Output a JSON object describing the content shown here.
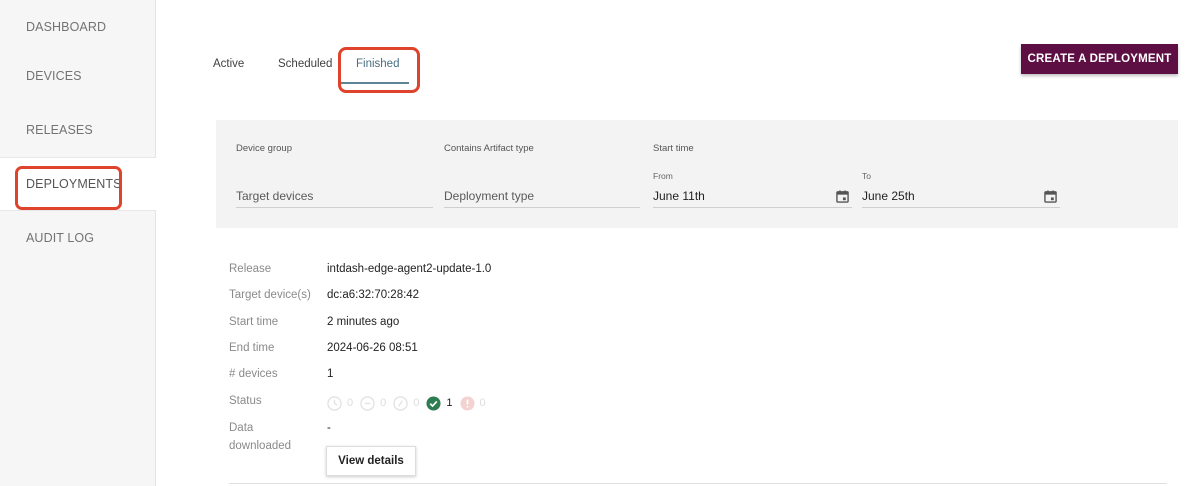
{
  "sidebar": {
    "items": [
      {
        "label": "DASHBOARD"
      },
      {
        "label": "DEVICES"
      },
      {
        "label": "RELEASES"
      },
      {
        "label": "DEPLOYMENTS"
      },
      {
        "label": "AUDIT LOG"
      }
    ],
    "active_item": "DEPLOYMENTS"
  },
  "tabs": [
    {
      "label": "Active"
    },
    {
      "label": "Scheduled"
    },
    {
      "label": "Finished"
    }
  ],
  "active_tab": "Finished",
  "create_button": {
    "label": "CREATE A DEPLOYMENT"
  },
  "filters": {
    "device_group": {
      "label": "Device group",
      "placeholder": "Target devices"
    },
    "artifact_type": {
      "label": "Contains Artifact type",
      "placeholder": "Deployment type"
    },
    "start_time": {
      "label": "Start time",
      "from": {
        "label": "From",
        "value": "June 11th"
      },
      "to": {
        "label": "To",
        "value": "June 25th"
      }
    }
  },
  "deployment": {
    "rows": [
      {
        "label": "Release",
        "value": "intdash-edge-agent2-update-1.0"
      },
      {
        "label": "Target device(s)",
        "value": "dc:a6:32:70:28:42"
      },
      {
        "label": "Start time",
        "value": "2 minutes ago"
      },
      {
        "label": "End time",
        "value": "2024-06-26 08:51"
      },
      {
        "label": "# devices",
        "value": "1"
      }
    ],
    "status": {
      "label": "Status",
      "counts": [
        {
          "icon": "pending-icon",
          "value": "0"
        },
        {
          "icon": "in-progress-icon",
          "value": "0"
        },
        {
          "icon": "paused-icon",
          "value": "0"
        },
        {
          "icon": "success-icon",
          "value": "1",
          "color": "#2e7d52"
        },
        {
          "icon": "failure-icon",
          "value": "0",
          "color": "#d9534f"
        }
      ]
    },
    "data_downloaded": {
      "label_line1": "Data",
      "label_line2": "downloaded",
      "value": "-"
    },
    "view_details_label": "View details"
  },
  "colors": {
    "accent": "#5d0f43",
    "tab_active": "#4a6f83",
    "highlight": "#e0432b"
  }
}
